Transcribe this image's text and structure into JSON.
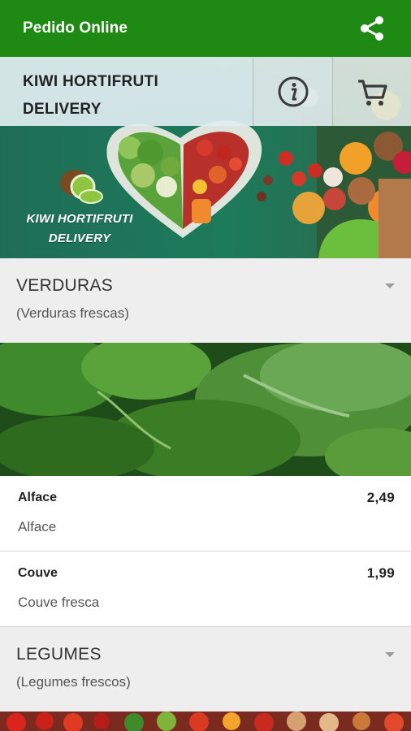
{
  "appbar": {
    "title": "Pedido Online",
    "share_icon": "share-icon",
    "color": "#1f8a13"
  },
  "store": {
    "name": "KIWI HORTIFRUTI DELIVERY",
    "info_icon": "info-icon",
    "cart_icon": "cart-icon",
    "logo_text": "KIWI HORTIFRUTI DELIVERY"
  },
  "categories": [
    {
      "title": "VERDURAS",
      "subtitle": "(Verduras frescas)",
      "products": [
        {
          "name": "Alface",
          "price": "2,49",
          "description": "Alface"
        },
        {
          "name": "Couve",
          "price": "1,99",
          "description": "Couve fresca"
        }
      ]
    },
    {
      "title": "LEGUMES",
      "subtitle": "(Legumes frescos)",
      "products": []
    }
  ]
}
